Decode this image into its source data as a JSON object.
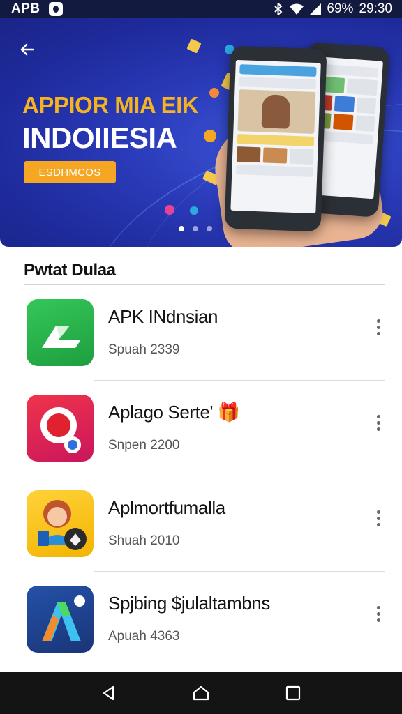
{
  "status_bar": {
    "carrier": "APB",
    "battery": "69%",
    "time": "29:30",
    "icons": [
      "notification-icon",
      "bluetooth-icon",
      "wifi-icon",
      "signal-icon"
    ]
  },
  "banner": {
    "title_line1": "APPIOR MIA EIK",
    "title_line2": "INDOIIESIA",
    "cta_label": "ESDHMCOS",
    "page_indicator": {
      "count": 3,
      "active_index": 0
    }
  },
  "section": {
    "title": "Pwtat Dulaa"
  },
  "apps": [
    {
      "name": "APK INdnsian",
      "subtitle": "Spuah 2339",
      "icon": "green-check-icon"
    },
    {
      "name": "Aplago Serte' 🎁",
      "subtitle": "Snpen 2200",
      "icon": "red-magnifier-icon"
    },
    {
      "name": "Aplmortfumalla",
      "subtitle": "Shuah 2010",
      "icon": "avatar-app-icon"
    },
    {
      "name": "Spjbing $julaltambns",
      "subtitle": "Apuah 4363",
      "icon": "letter-a-app-icon"
    }
  ],
  "nav_bar": {
    "buttons": [
      "back-icon",
      "home-icon",
      "recents-icon"
    ]
  },
  "colors": {
    "banner_blue": "#2a3ab8",
    "title_gold": "#f5b321",
    "cta_orange": "#f5a623",
    "status_bar": "#121a3f"
  }
}
